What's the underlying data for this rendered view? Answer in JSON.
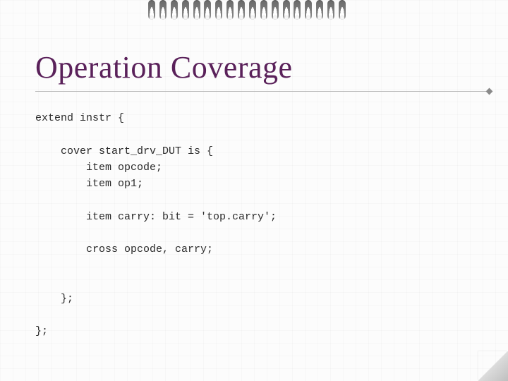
{
  "title": "Operation Coverage",
  "code": {
    "l1": "extend instr {",
    "l2": "    cover start_drv_DUT is {",
    "l3": "        item opcode;",
    "l4": "        item op1;",
    "l5": "        item carry: bit = 'top.carry';",
    "l6": "        cross opcode, carry;",
    "l7": "    };",
    "l8": "};"
  }
}
